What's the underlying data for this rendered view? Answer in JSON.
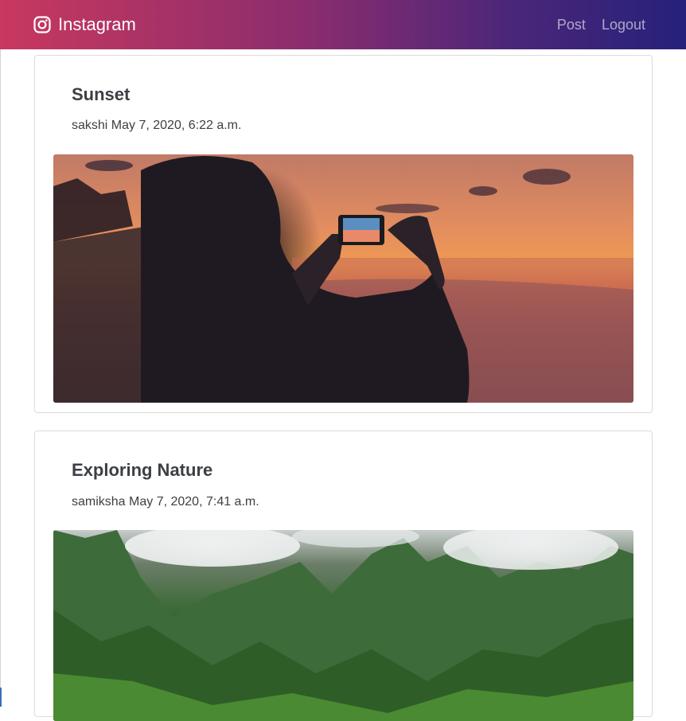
{
  "navbar": {
    "brand": "Instagram",
    "brand_icon": "instagram-icon",
    "links": [
      {
        "label": "Post"
      },
      {
        "label": "Logout"
      }
    ]
  },
  "posts": [
    {
      "title": "Sunset",
      "author": "sakshi",
      "date": "May 7, 2020, 6:22 a.m.",
      "meta": "sakshi May 7, 2020, 6:22 a.m.",
      "image": "photo of a person taking a phone picture of a sunset over the sea"
    },
    {
      "title": "Exploring Nature",
      "author": "samiksha",
      "date": "May 7, 2020, 7:41 a.m.",
      "meta": "samiksha May 7, 2020, 7:41 a.m.",
      "image": "photo of green mountains with low clouds"
    }
  ]
}
